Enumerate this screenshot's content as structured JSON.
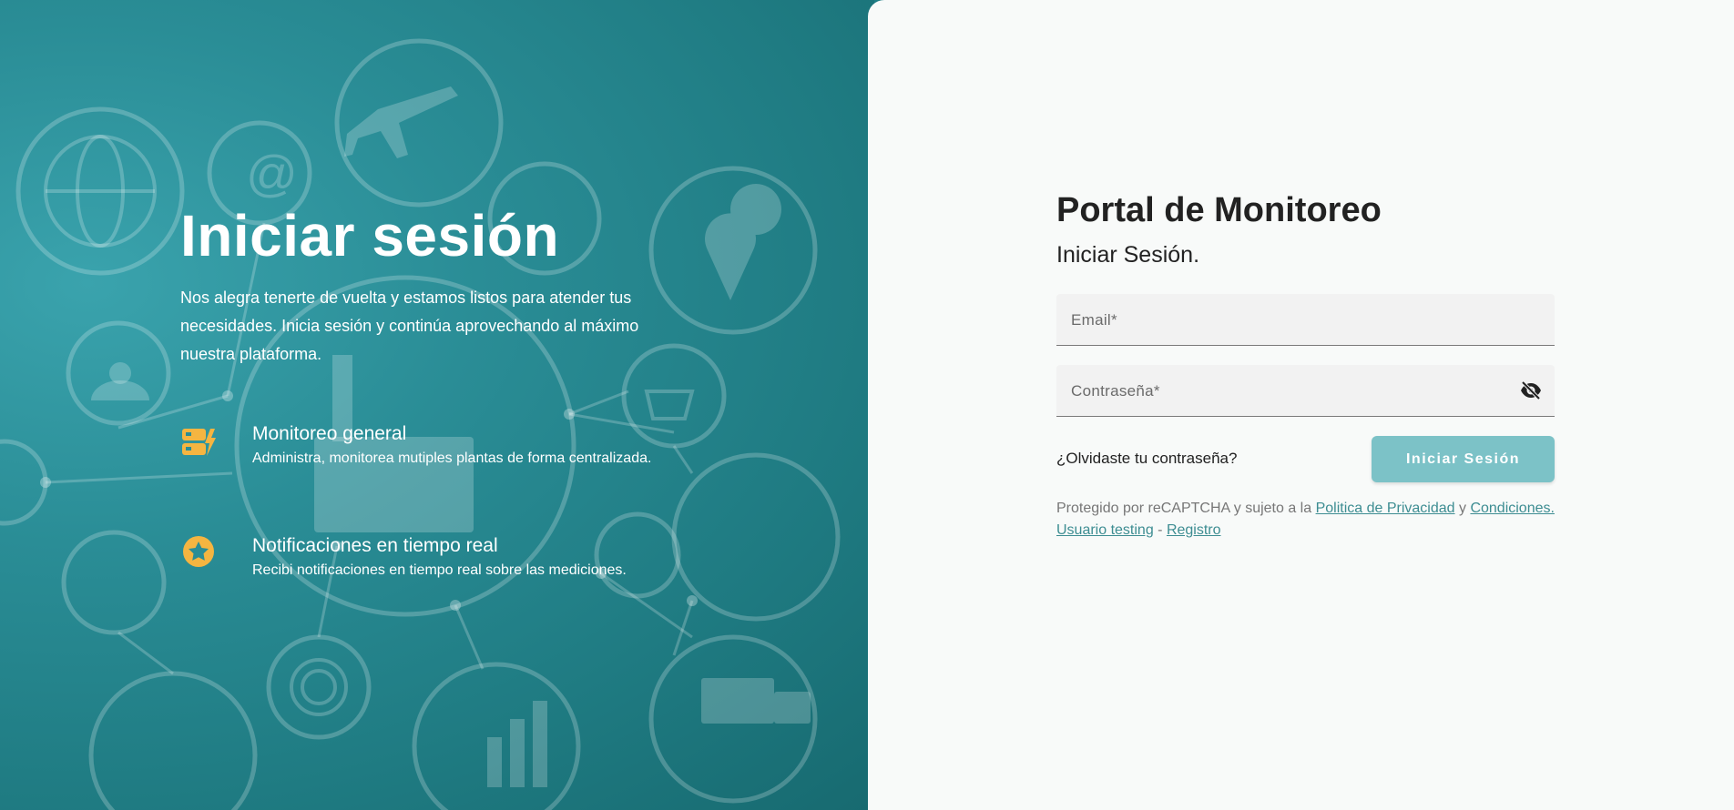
{
  "hero": {
    "title": "Iniciar sesión",
    "description": "Nos alegra tenerte de vuelta y estamos listos para atender tus necesidades. Inicia sesión y continúa aprovechando al máximo nuestra plataforma."
  },
  "features": [
    {
      "icon": "server-bolt-icon",
      "title": "Monitoreo general",
      "description": "Administra, monitorea mutiples plantas de forma centralizada."
    },
    {
      "icon": "star-badge-icon",
      "title": "Notificaciones en tiempo real",
      "description": "Recibi notificaciones en tiempo real sobre las mediciones."
    }
  ],
  "login": {
    "title": "Portal de Monitoreo",
    "subtitle": "Iniciar Sesión.",
    "email_label": "Email*",
    "password_label": "Contraseña*",
    "forgot_password": "¿Olvidaste tu contraseña?",
    "submit_label": "Iniciar Sesión"
  },
  "legal": {
    "prefix": "Protegido por reCAPTCHA y sujeto a la ",
    "privacy_link": "Politica de Privacidad",
    "and": " y ",
    "terms_link": "Condiciones.",
    "testing_link": "Usuario testing",
    "separator": " - ",
    "register_link": "Registro"
  },
  "colors": {
    "accent_teal": "#2a8d96",
    "button_teal": "#7cc2c7",
    "feature_icon": "#f5b541",
    "link": "#3d8d92"
  }
}
